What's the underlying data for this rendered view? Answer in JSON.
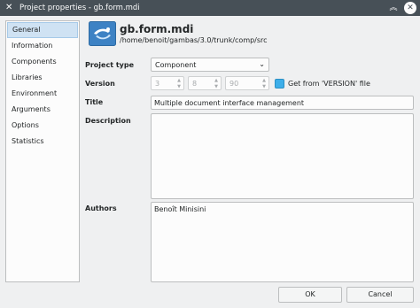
{
  "window": {
    "title": "Project properties - gb.form.mdi"
  },
  "sidebar": {
    "items": [
      {
        "label": "General",
        "selected": true
      },
      {
        "label": "Information"
      },
      {
        "label": "Components"
      },
      {
        "label": "Libraries"
      },
      {
        "label": "Environment"
      },
      {
        "label": "Arguments"
      },
      {
        "label": "Options"
      },
      {
        "label": "Statistics"
      }
    ]
  },
  "header": {
    "name": "gb.form.mdi",
    "path": "/home/benoit/gambas/3.0/trunk/comp/src"
  },
  "form": {
    "project_type_label": "Project type",
    "project_type_value": "Component",
    "version_label": "Version",
    "version_major": "3",
    "version_minor": "8",
    "version_release": "90",
    "version_from_file_label": "Get from 'VERSION' file",
    "version_from_file_checked": true,
    "title_label": "Title",
    "title_value": "Multiple document interface management",
    "description_label": "Description",
    "description_value": "",
    "authors_label": "Authors",
    "authors_value": "Benoît Minisini"
  },
  "buttons": {
    "ok": "OK",
    "cancel": "Cancel"
  },
  "colors": {
    "accent": "#3daee9",
    "titlebar": "#475057",
    "selection": "#cfe2f3"
  }
}
